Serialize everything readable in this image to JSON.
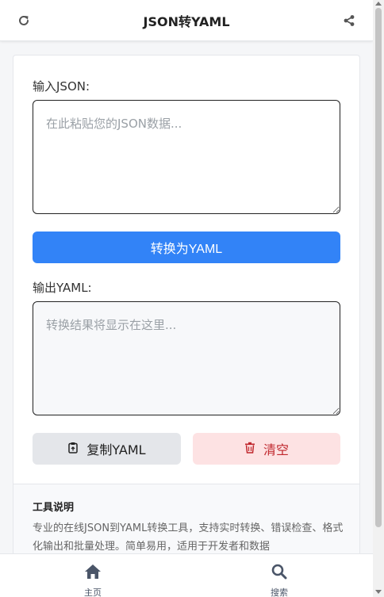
{
  "header": {
    "title": "JSON转YAML",
    "refresh_icon": "refresh-icon",
    "share_icon": "share-icon"
  },
  "input": {
    "label": "输入JSON:",
    "placeholder": "在此粘贴您的JSON数据...",
    "value": ""
  },
  "convert_button": {
    "label": "转换为YAML",
    "color": "#3283f7"
  },
  "output": {
    "label": "输出YAML:",
    "placeholder": "转换结果将显示在这里...",
    "value": ""
  },
  "actions": {
    "copy_label": "复制YAML",
    "copy_icon": "clipboard-icon",
    "clear_label": "清空",
    "clear_icon": "trash-icon",
    "clear_color": "#c0272d"
  },
  "description": {
    "title": "工具说明",
    "text": "专业的在线JSON到YAML转换工具，支持实时转换、错误检查、格式化输出和批量处理。简单易用，适用于开发者和数据"
  },
  "nav": {
    "items": [
      {
        "label": "主页",
        "icon": "home-icon"
      },
      {
        "label": "搜索",
        "icon": "search-icon"
      }
    ]
  }
}
